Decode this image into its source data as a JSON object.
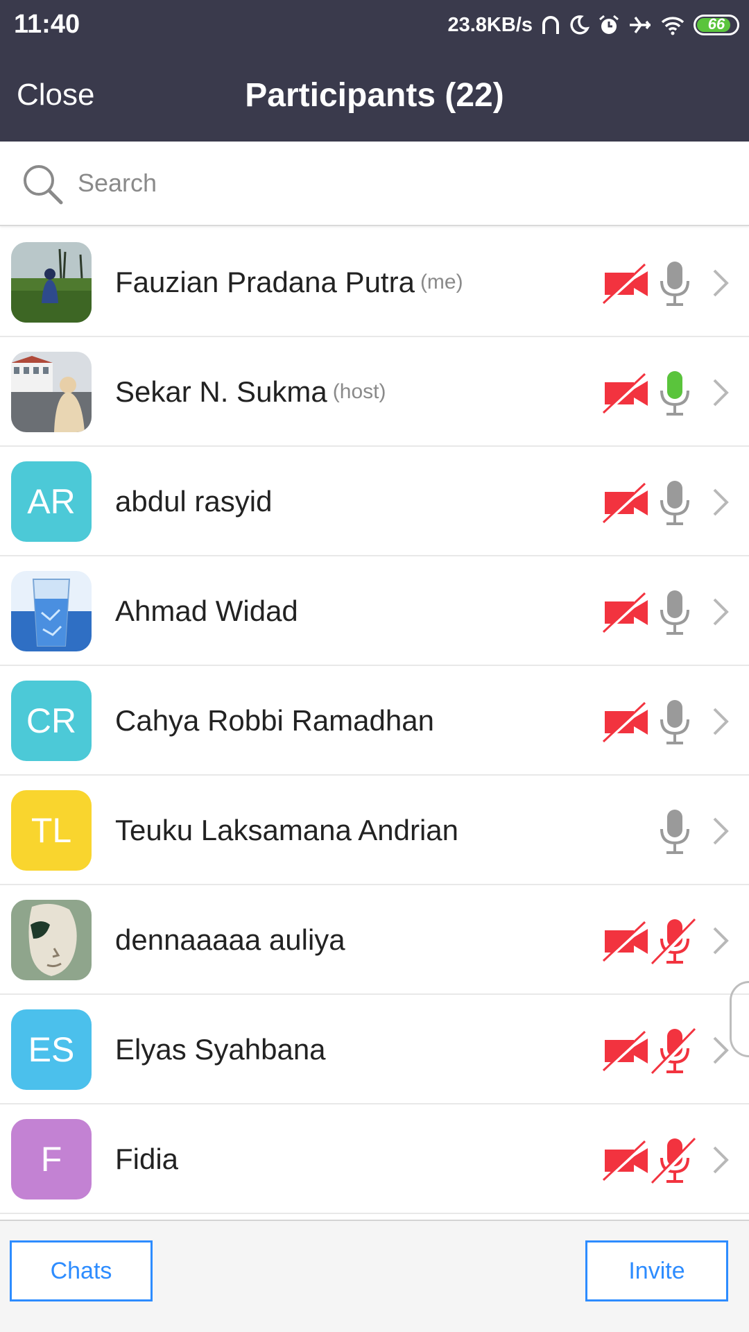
{
  "status_bar": {
    "time": "11:40",
    "network_speed": "23.8KB/s",
    "battery_level": "66",
    "battery_color": "#5ac43c"
  },
  "header": {
    "close_label": "Close",
    "title": "Participants (22)",
    "background": "#3a3a4c"
  },
  "search": {
    "placeholder": "Search",
    "value": ""
  },
  "participants": [
    {
      "name": "Fauzian Pradana Putra",
      "tag": "(me)",
      "avatar": "photo-tea-field",
      "video": "video-off",
      "audio": "mic-on"
    },
    {
      "name": "Sekar N. Sukma",
      "tag": "(host)",
      "avatar": "photo-street",
      "video": "video-off",
      "audio": "mic-speaking"
    },
    {
      "name": "abdul rasyid",
      "tag": "",
      "initials": "AR",
      "avatar_color": "#4cc9d7",
      "video": "video-off",
      "audio": "mic-on"
    },
    {
      "name": "Ahmad Widad",
      "tag": "",
      "avatar": "photo-water-glass",
      "video": "video-off",
      "audio": "mic-on"
    },
    {
      "name": "Cahya Robbi Ramadhan",
      "tag": "",
      "initials": "CR",
      "avatar_color": "#4cc9d7",
      "video": "video-off",
      "audio": "mic-on"
    },
    {
      "name": "Teuku Laksamana Andrian",
      "tag": "",
      "initials": "TL",
      "avatar_color": "#f9d52e",
      "video": "none",
      "audio": "mic-on"
    },
    {
      "name": "dennaaaaa auliya",
      "tag": "",
      "avatar": "photo-statue",
      "video": "video-off",
      "audio": "mic-muted"
    },
    {
      "name": "Elyas Syahbana",
      "tag": "",
      "initials": "ES",
      "avatar_color": "#4bc0ec",
      "video": "video-off",
      "audio": "mic-muted"
    },
    {
      "name": "Fidia",
      "tag": "",
      "initials": "F",
      "avatar_color": "#c382d3",
      "video": "video-off",
      "audio": "mic-muted"
    }
  ],
  "icon_colors": {
    "muted_red": "#f2333f",
    "mic_gray": "#9a9a9a",
    "speaking_green": "#5ac43c",
    "chevron_gray": "#b8b8b8"
  },
  "footer": {
    "chats_label": "Chats",
    "invite_label": "Invite",
    "accent": "#2d8cff"
  }
}
